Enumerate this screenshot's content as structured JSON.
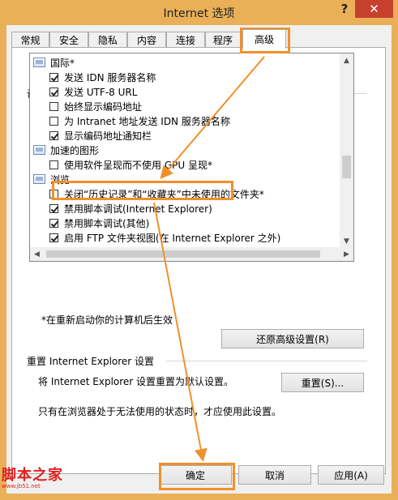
{
  "window": {
    "title": "Internet 选项"
  },
  "titlebar": {
    "help": "?",
    "close": "✕"
  },
  "tabs": [
    {
      "label": "常规"
    },
    {
      "label": "安全"
    },
    {
      "label": "隐私"
    },
    {
      "label": "内容"
    },
    {
      "label": "连接"
    },
    {
      "label": "程序"
    },
    {
      "label": "高级",
      "active": true
    }
  ],
  "settings": {
    "group_label": "设置",
    "items": [
      {
        "type": "category",
        "label": "国际*"
      },
      {
        "type": "checkbox",
        "checked": true,
        "label": "发送 IDN 服务器名称"
      },
      {
        "type": "checkbox",
        "checked": true,
        "label": "发送 UTF-8 URL"
      },
      {
        "type": "checkbox",
        "checked": false,
        "label": "始终显示编码地址"
      },
      {
        "type": "checkbox",
        "checked": false,
        "label": "为 Intranet 地址发送 IDN 服务器名称"
      },
      {
        "type": "checkbox",
        "checked": true,
        "label": "显示编码地址通知栏"
      },
      {
        "type": "category",
        "label": "加速的图形"
      },
      {
        "type": "checkbox",
        "checked": false,
        "label": "使用软件呈现而不使用 GPU 呈现*"
      },
      {
        "type": "category",
        "label": "浏览"
      },
      {
        "type": "checkbox",
        "checked": false,
        "label": "关闭“历史记录”和“收藏夹”中未使用的文件夹*"
      },
      {
        "type": "checkbox",
        "checked": true,
        "label": "禁用脚本调试(Internet Explorer)"
      },
      {
        "type": "checkbox",
        "checked": true,
        "label": "禁用脚本调试(其他)"
      },
      {
        "type": "checkbox",
        "checked": true,
        "label": "启用 FTP 文件夹视图(在 Internet Explorer 之外)"
      }
    ],
    "restart_note": "*在重新启动你的计算机后生效",
    "restore_button": "还原高级设置(R)"
  },
  "reset": {
    "group_label": "重置 Internet Explorer 设置",
    "description": "将 Internet Explorer 设置重置为默认设置。",
    "reset_button": "重置(S)...",
    "warning": "只有在浏览器处于无法使用的状态时，才应使用此设置。"
  },
  "footer": {
    "ok": "确定",
    "cancel": "取消",
    "apply": "应用(A)"
  },
  "watermark": {
    "main": "脚本之家",
    "url": "www.jb51.net"
  },
  "colors": {
    "highlight": "#f0902b",
    "close": "#c7402d",
    "frame": "#eab058"
  }
}
